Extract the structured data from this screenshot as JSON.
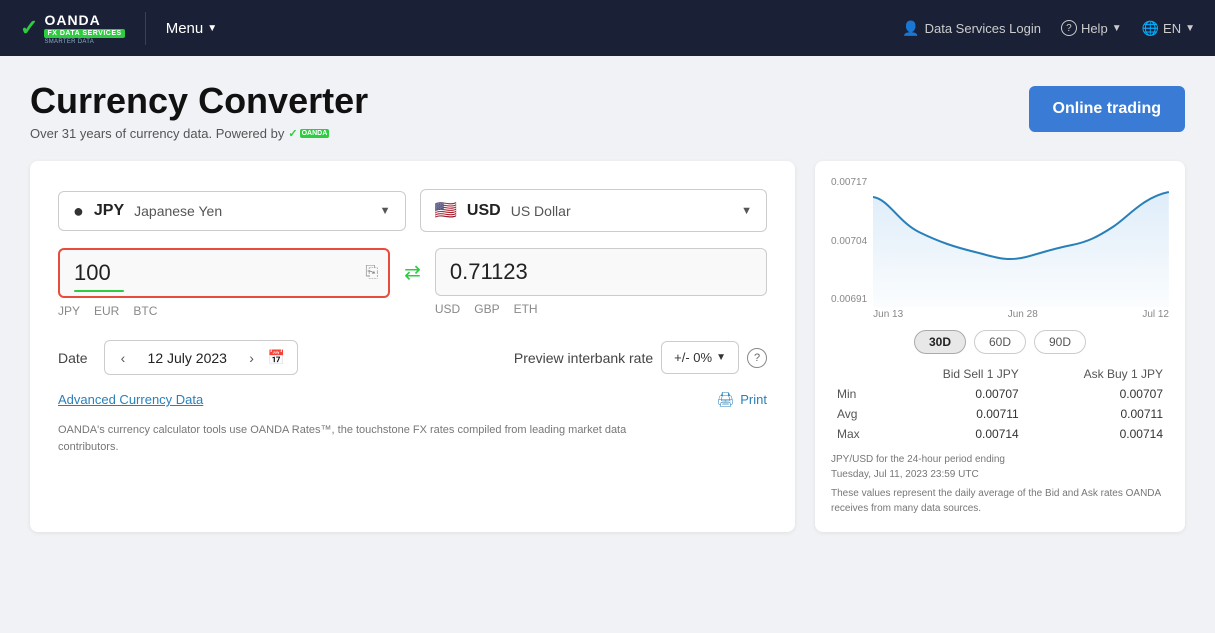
{
  "nav": {
    "brand": "OANDA",
    "brand_tagline": "FX DATA SERVICES",
    "menu_label": "Menu",
    "data_services_login": "Data Services Login",
    "help": "Help",
    "lang": "EN"
  },
  "header": {
    "title": "Currency Converter",
    "subtitle": "Over 31 years of currency data. Powered by",
    "subtitle_brand": "OANDA",
    "online_trading_btn": "Online trading"
  },
  "from_currency": {
    "flag": "🔴",
    "code": "JPY",
    "name": "Japanese Yen"
  },
  "to_currency": {
    "flag_emoji": "🇺🇸",
    "code": "USD",
    "name": "US Dollar"
  },
  "from_amount": "100",
  "to_amount": "0.71123",
  "from_shortcuts": [
    "JPY",
    "EUR",
    "BTC"
  ],
  "to_shortcuts": [
    "USD",
    "GBP",
    "ETH"
  ],
  "date": {
    "label": "Date",
    "value": "12 July 2023"
  },
  "preview_rate": {
    "label": "Preview interbank rate",
    "value": "+/- 0%"
  },
  "links": {
    "advanced": "Advanced Currency Data",
    "print": "Print"
  },
  "disclaimer": "OANDA's currency calculator tools use OANDA Rates™, the touchstone FX rates compiled from leading market data contributors.",
  "chart": {
    "y_labels": [
      "0.00717",
      "0.00704",
      "0.00691"
    ],
    "x_labels": [
      "Jun 13",
      "Jun 28",
      "Jul 12"
    ],
    "periods": [
      "30D",
      "60D",
      "90D"
    ],
    "active_period": "30D"
  },
  "stats": {
    "col1": "Bid Sell 1 JPY",
    "col2": "Ask Buy 1 JPY",
    "rows": [
      {
        "label": "Min",
        "bid": "0.00707",
        "ask": "0.00707"
      },
      {
        "label": "Avg",
        "bid": "0.00711",
        "ask": "0.00711"
      },
      {
        "label": "Max",
        "bid": "0.00714",
        "ask": "0.00714"
      }
    ]
  },
  "stats_note_line1": "JPY/USD for the 24-hour period ending",
  "stats_note_line2": "Tuesday, Jul 11, 2023 23:59 UTC",
  "stats_note_line3": "These values represent the daily average of the Bid and Ask rates OANDA receives from many data sources."
}
